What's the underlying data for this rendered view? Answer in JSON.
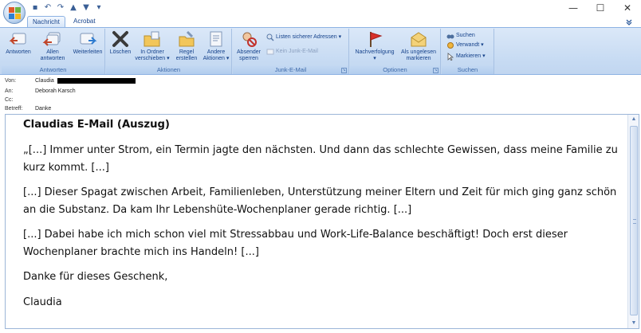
{
  "titlebar": {
    "office_button": "office-button",
    "quick_access": [
      {
        "icon": "save-icon",
        "glyph": "▪"
      },
      {
        "icon": "undo-icon",
        "glyph": "↶"
      },
      {
        "icon": "redo-icon",
        "glyph": "↷"
      },
      {
        "icon": "previous-item-icon",
        "glyph": "▲"
      },
      {
        "icon": "next-item-icon",
        "glyph": "▼"
      },
      {
        "icon": "customize-toolbar-icon",
        "glyph": "▾"
      }
    ],
    "window_controls": {
      "minimize": "—",
      "maximize": "☐",
      "close": "✕"
    }
  },
  "tabs": [
    {
      "label": "Nachricht",
      "active": true
    },
    {
      "label": "Acrobat",
      "active": false
    }
  ],
  "ribbon": {
    "groups": {
      "antworten": {
        "label": "Antworten",
        "buttons": [
          {
            "label": "Antworten",
            "icon": "reply-icon"
          },
          {
            "label_1": "Allen",
            "label_2": "antworten",
            "icon": "reply-all-icon"
          },
          {
            "label": "Weiterleiten",
            "icon": "forward-icon"
          }
        ]
      },
      "aktionen": {
        "label": "Aktionen",
        "buttons": [
          {
            "label": "Löschen",
            "icon": "delete-icon"
          },
          {
            "label_1": "In Ordner",
            "label_2": "verschieben ▾",
            "icon": "move-to-folder-icon"
          },
          {
            "label_1": "Regel",
            "label_2": "erstellen",
            "icon": "create-rule-icon"
          },
          {
            "label_1": "Andere",
            "label_2": "Aktionen ▾",
            "icon": "other-actions-icon"
          }
        ]
      },
      "junk": {
        "label": "Junk-E-Mail",
        "absender_1": "Absender",
        "absender_2": "sperren",
        "listen": "Listen sicherer Adressen ▾",
        "kein_junk": "Kein Junk-E-Mail"
      },
      "optionen": {
        "label": "Optionen",
        "nachverfolgung": "Nachverfolgung",
        "ungelesen_1": "Als ungelesen",
        "ungelesen_2": "markieren"
      },
      "suchen": {
        "label": "Suchen",
        "suchen": "Suchen",
        "verwandt": "Verwandt ▾",
        "markieren": "Markieren ▾"
      }
    }
  },
  "header": {
    "von_label": "Von:",
    "von_value": "Claudia",
    "an_label": "An:",
    "an_value": "Deborah Karsch",
    "cc_label": "Cc:",
    "cc_value": "",
    "betreff_label": "Betreff:",
    "betreff_value": "Danke"
  },
  "message": {
    "title": "Claudias E-Mail (Auszug)",
    "paragraphs": [
      "„[...] Immer unter Strom, ein Termin jagte den nächsten. Und dann das schlechte Gewissen, dass meine Familie zu kurz kommt. [...]",
      "[...] Dieser Spagat zwischen Arbeit, Familienleben, Unterstützung meiner Eltern und Zeit für mich ging ganz schön an die Substanz. Da kam Ihr Lebenshüte-Wochenplaner gerade richtig. [...]",
      "[...] Dabei habe ich mich schon viel mit Stressabbau und Work-Life-Balance beschäftigt! Doch erst dieser Wochenplaner brachte mich ins Handeln! [...]",
      "Danke für dieses Geschenk,",
      "Claudia"
    ]
  },
  "scrollbar": {
    "up": "▲",
    "down": "▼"
  }
}
